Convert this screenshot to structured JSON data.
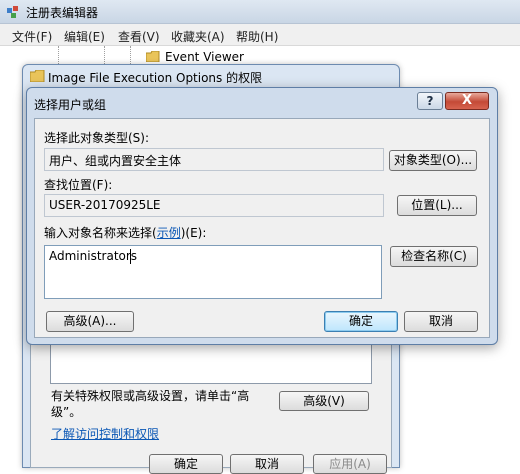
{
  "registry": {
    "title": "注册表编辑器",
    "menu": [
      "文件(F)",
      "编辑(E)",
      "查看(V)",
      "收藏夹(A)",
      "帮助(H)"
    ],
    "tree_item": "Event Viewer"
  },
  "permissions": {
    "title": "Image File Execution Options 的权限",
    "note": "有关特殊权限或高级设置，请单击“高级”。",
    "advanced_label": "高级(V)",
    "link": "了解访问控制和权限",
    "ok_label": "确定",
    "cancel_label": "取消",
    "apply_label": "应用(A)"
  },
  "select_dialog": {
    "title": "选择用户或组",
    "help_label": "?",
    "close_label": "X",
    "object_type_label": "选择此对象类型(S):",
    "object_type_value": "用户、组或内置安全主体",
    "object_types_button": "对象类型(O)...",
    "location_label": "查找位置(F):",
    "location_value": "USER-20170925LE",
    "location_button": "位置(L)...",
    "names_label_prefix": "输入对象名称来选择(",
    "names_label_link": "示例",
    "names_label_suffix": ")(E):",
    "names_value": "Administrators",
    "check_names_button": "检查名称(C)",
    "advanced_button": "高级(A)...",
    "ok_button": "确定",
    "cancel_button": "取消"
  }
}
